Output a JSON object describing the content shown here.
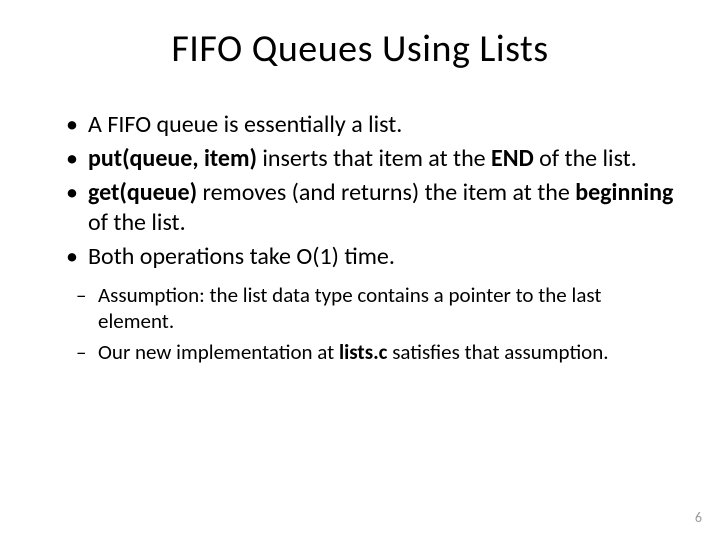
{
  "title": "FIFO Queues Using Lists",
  "bullets": [
    {
      "html": "A FIFO queue is essentially a list."
    },
    {
      "html": "<span class=\"b\">put(queue, item)</span> inserts that item at the <span class=\"b\">END</span> of the list."
    },
    {
      "html": "<span class=\"b\">get(queue)</span> removes (and returns) the item at the <span class=\"b\">beginning</span> of the list."
    },
    {
      "html": "Both operations take O(1) time."
    }
  ],
  "sub_bullets": [
    {
      "html": "Assumption: the list data type contains a pointer to the last element."
    },
    {
      "html": "Our new implementation at <span class=\"b\">lists.c</span> satisfies that assumption."
    }
  ],
  "page_number": "6"
}
